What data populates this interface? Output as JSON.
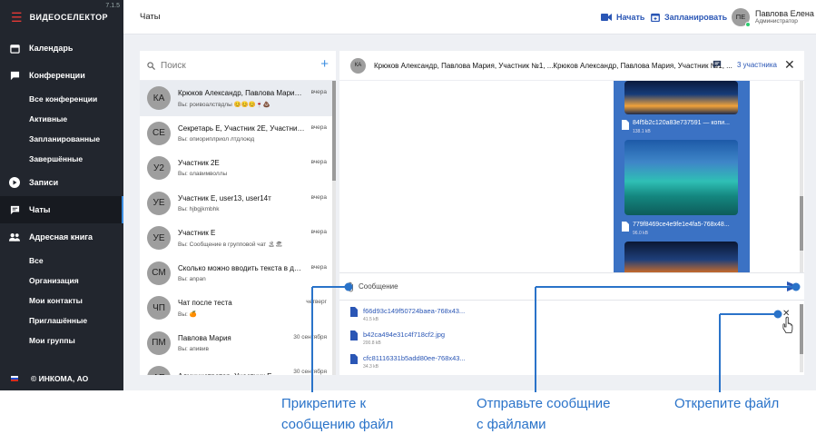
{
  "app": {
    "logo": "ВИДЕОСЕЛЕКТОР",
    "version": "7.1.5"
  },
  "sidebar": {
    "nav": [
      {
        "label": "Календарь"
      },
      {
        "label": "Конференции"
      },
      {
        "label": "Все конференции"
      },
      {
        "label": "Активные"
      },
      {
        "label": "Запланированные"
      },
      {
        "label": "Завершённые"
      },
      {
        "label": "Записи"
      },
      {
        "label": "Чаты"
      },
      {
        "label": "Адресная книга"
      },
      {
        "label": "Все"
      },
      {
        "label": "Организация"
      },
      {
        "label": "Мои контакты"
      },
      {
        "label": "Приглашённые"
      },
      {
        "label": "Мои группы"
      }
    ],
    "footer": "© ИНКОМА, АО"
  },
  "header": {
    "title": "Чаты",
    "start_label": "Начать",
    "schedule_label": "Запланировать",
    "user_initials": "ПЕ",
    "user_name": "Павлова Елена",
    "user_role": "Администратор"
  },
  "chat_list": {
    "search_placeholder": "Поиск",
    "items": [
      {
        "initials": "КА",
        "name": "Крюков Александр, Павлова Мария, Участник №1, ...",
        "last": "Вы: роивоалствдлы 😊😊😊🍷💩",
        "time": "вчера"
      },
      {
        "initials": "СЕ",
        "name": "Секретарь Е, Участник 2Е, Участник Е",
        "last": "Вы: опиориплриол лтдлоюд",
        "time": "вчера"
      },
      {
        "initials": "У2",
        "name": "Участник 2Е",
        "last": "Вы: олавимволлы",
        "time": "вчера"
      },
      {
        "initials": "УЕ",
        "name": "Участник Е, user13, user14т",
        "last": "Вы: hjbgjkmbhk",
        "time": "вчера"
      },
      {
        "initials": "УЕ",
        "name": "Участник Е",
        "last": "Вы: Сообщение в групповой чат 🏝🏖",
        "time": "вчера"
      },
      {
        "initials": "СМ",
        "name": "Сколько можно вводить текста в данное поле",
        "last": "Вы: anpan",
        "time": "вчера"
      },
      {
        "initials": "ЧП",
        "name": "Чат после теста",
        "last": "Вы: 🍊",
        "time": "четверг"
      },
      {
        "initials": "ПМ",
        "name": "Павлова Мария",
        "last": "Вы: апивив",
        "time": "30 сентября"
      },
      {
        "initials": "АЕ",
        "name": "Администратор, Участник Е",
        "last": "",
        "time": "30 сентября"
      }
    ]
  },
  "chat": {
    "avatar": "КА",
    "title": "Крюков Александр, Павлова Мария, Участник №1, ...Крюков Александр, Павлова Мария, Участник №1, ...",
    "participants": "3 участника",
    "messages": [
      {
        "file": "84f5b2c120a83e737591 — копи...",
        "size": "138.1 kB"
      },
      {
        "file": "779f8469ce4e9fe1e4fa5-768x48...",
        "size": "96.0 kB"
      }
    ],
    "input_placeholder": "Сообщение",
    "attachments": [
      {
        "name": "f66d93c149f50724baea-768x43...",
        "size": "41.5 kB"
      },
      {
        "name": "b42ca494e31c4f718cf2.jpg",
        "size": "200.8 kB"
      },
      {
        "name": "cfc81116331b5add80ee-768x43...",
        "size": "34.3 kB"
      }
    ]
  },
  "callouts": {
    "attach": [
      "Прикрепите к",
      "сообщению файл"
    ],
    "send": [
      "Отправьте сообщние",
      "с файлами"
    ],
    "detach": [
      "Открепите файл"
    ]
  },
  "colors": {
    "sidebar_bg": "#22262e",
    "accent": "#3b8de0",
    "link": "#2a56b5",
    "callout": "#2a73c9",
    "bubble": "#3b72c4",
    "logo_accent": "#e53935"
  }
}
